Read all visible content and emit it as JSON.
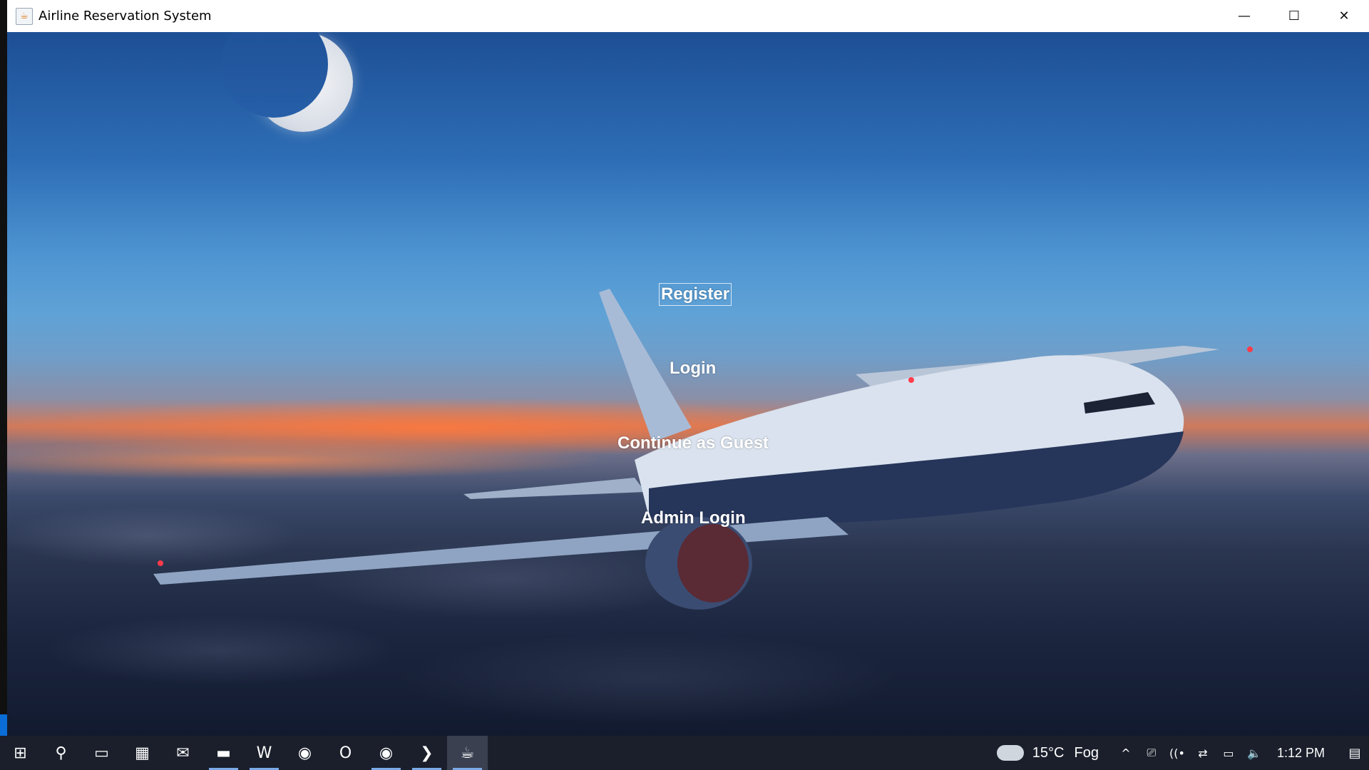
{
  "window": {
    "title": "Airline Reservation System",
    "icon": "java-app-icon",
    "controls": {
      "minimize": "—",
      "maximize": "☐",
      "close": "✕"
    }
  },
  "menu": {
    "register": "Register",
    "login": "Login",
    "guest": "Continue as Guest",
    "admin": "Admin Login"
  },
  "taskbar": {
    "items": [
      {
        "name": "start-icon",
        "glyph": "⊞"
      },
      {
        "name": "search-icon",
        "glyph": "⚲"
      },
      {
        "name": "task-view-icon",
        "glyph": "▭"
      },
      {
        "name": "store-icon",
        "glyph": "▦"
      },
      {
        "name": "mail-icon",
        "glyph": "✉"
      },
      {
        "name": "file-explorer-icon",
        "glyph": "▬"
      },
      {
        "name": "word-icon",
        "glyph": "W"
      },
      {
        "name": "chrome-icon",
        "glyph": "◉"
      },
      {
        "name": "opera-icon",
        "glyph": "O"
      },
      {
        "name": "chrome-alt-icon",
        "glyph": "◉"
      },
      {
        "name": "vscode-icon",
        "glyph": "❯"
      },
      {
        "name": "java-app-icon",
        "glyph": "☕"
      }
    ],
    "weather": {
      "temp": "15°C",
      "condition": "Fog"
    },
    "tray": [
      "^",
      "⎚",
      "((•",
      "⇄",
      "▭",
      "🔈"
    ],
    "clock": "1:12 PM",
    "notification_glyph": "▤"
  }
}
